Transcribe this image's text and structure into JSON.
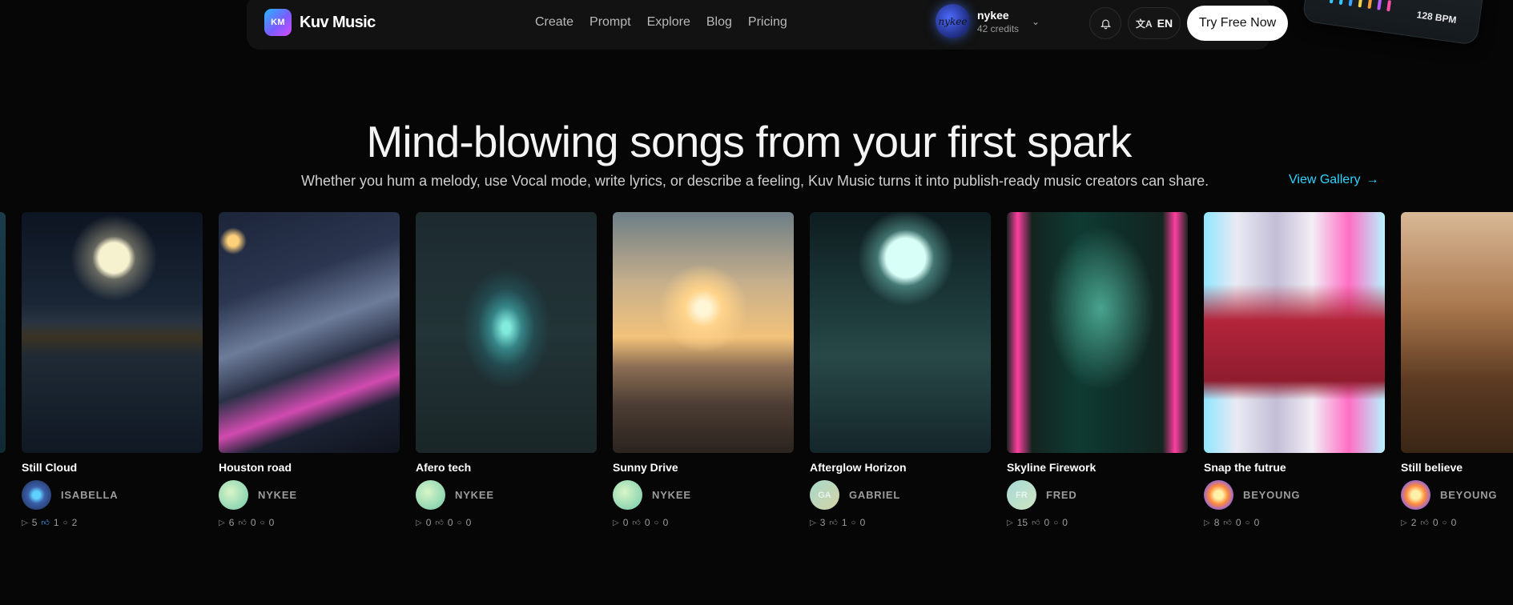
{
  "nav": {
    "logo_badge": "KM",
    "logo_text": "Kuv Music",
    "links": [
      "Create",
      "Prompt",
      "Explore",
      "Blog",
      "Pricing"
    ],
    "user": {
      "name": "nykee",
      "credits": "42 credits",
      "avatar_text": "nykee"
    },
    "lang": "EN",
    "cta": "Try Free Now"
  },
  "bpm_widget": {
    "label": "128 BPM",
    "bar_colors": [
      "#39c6ff",
      "#39c6ff",
      "#3aa3ff",
      "#f2d14b",
      "#f59d3a",
      "#b85cff",
      "#ff4fa8"
    ]
  },
  "hero": {
    "title": "Mind-blowing songs from your first spark",
    "subtitle": "Whether you hum a melody, use Vocal mode, write lyrics, or describe a feeling, Kuv Music turns it into publish-ready music creators can share.",
    "view_gallery": "View Gallery"
  },
  "songs": [
    {
      "title": "Still Cloud",
      "artist": "ISABELLA",
      "avatar_initials": "",
      "plays": "5",
      "likes": "1",
      "comments": "2",
      "liked": true
    },
    {
      "title": "Houston road",
      "artist": "NYKEE",
      "avatar_initials": "",
      "plays": "6",
      "likes": "0",
      "comments": "0",
      "liked": false
    },
    {
      "title": "Afero tech",
      "artist": "NYKEE",
      "avatar_initials": "",
      "plays": "0",
      "likes": "0",
      "comments": "0",
      "liked": false
    },
    {
      "title": "Sunny Drive",
      "artist": "NYKEE",
      "avatar_initials": "",
      "plays": "0",
      "likes": "0",
      "comments": "0",
      "liked": false
    },
    {
      "title": "Afterglow Horizon",
      "artist": "GABRIEL",
      "avatar_initials": "GA",
      "plays": "3",
      "likes": "1",
      "comments": "0",
      "liked": false
    },
    {
      "title": "Skyline Firework",
      "artist": "FRED",
      "avatar_initials": "FR",
      "plays": "15",
      "likes": "0",
      "comments": "0",
      "liked": false
    },
    {
      "title": "Snap the futrue",
      "artist": "BEYOUNG",
      "avatar_initials": "",
      "plays": "8",
      "likes": "0",
      "comments": "0",
      "liked": false
    },
    {
      "title": "Still believe",
      "artist": "BEYOUNG",
      "avatar_initials": "",
      "plays": "2",
      "likes": "0",
      "comments": "0",
      "liked": false
    }
  ]
}
